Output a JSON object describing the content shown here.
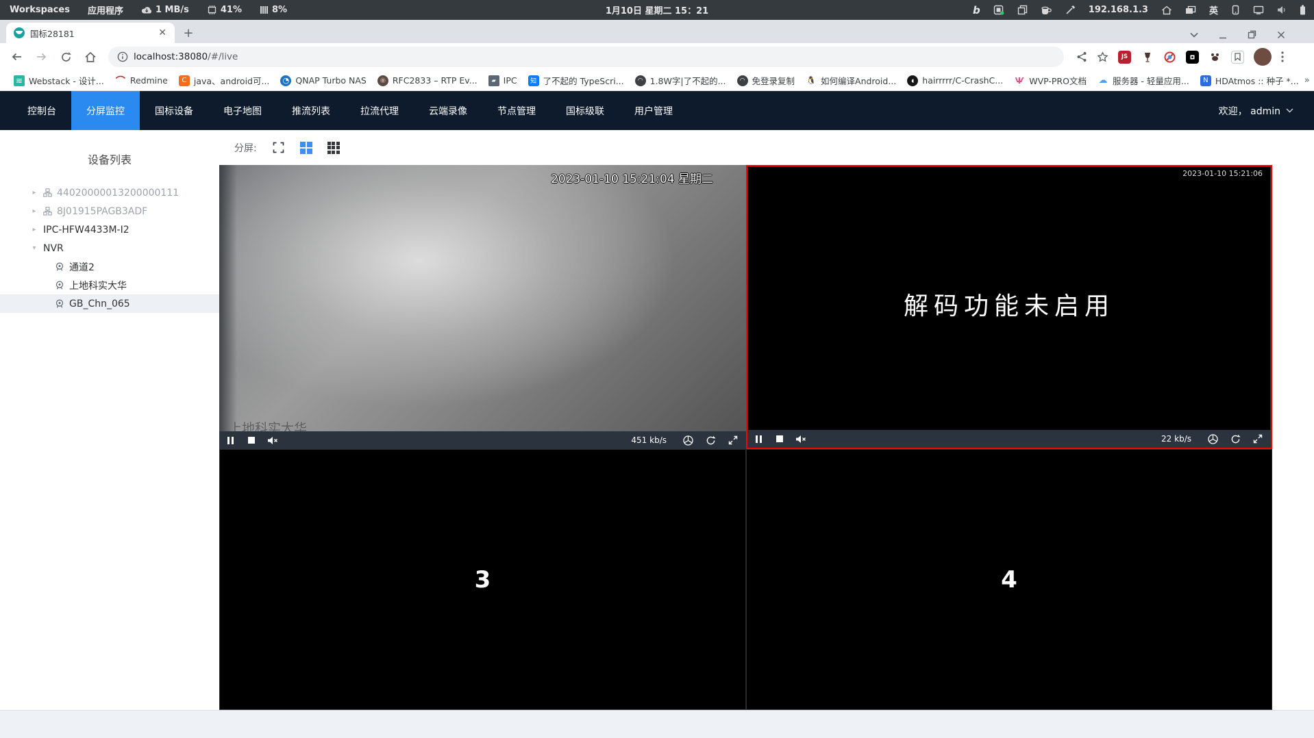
{
  "sysbar": {
    "workspaces": "Workspaces",
    "applications": "应用程序",
    "net_speed": "1 MB/s",
    "cpu": "41%",
    "mem": "8%",
    "clock": "1月10日 星期二 15：21",
    "ip": "192.168.1.3",
    "lang": "英"
  },
  "browser": {
    "tab_title": "国标28181",
    "close_glyph": "✕",
    "new_tab_glyph": "+",
    "url": {
      "host": "localhost:38080",
      "path": "/#/live"
    },
    "bookmarks": [
      {
        "label": "Webstack - 设计...",
        "icon": "layers-icon"
      },
      {
        "label": "Redmine",
        "icon": "redmine-icon"
      },
      {
        "label": "java、android可...",
        "icon": "c-badge-icon"
      },
      {
        "label": "QNAP Turbo NAS",
        "icon": "qnap-icon"
      },
      {
        "label": "RFC2833 – RTP Ev...",
        "icon": "knob-icon"
      },
      {
        "label": "IPC",
        "icon": "folder-icon"
      },
      {
        "label": "了不起的 TypeScri...",
        "icon": "zhihu-icon"
      },
      {
        "label": "1.8W字|了不起的...",
        "icon": "globe-icon"
      },
      {
        "label": "免登录复制",
        "icon": "globe-icon"
      },
      {
        "label": "如何编译Android...",
        "icon": "penguin-icon"
      },
      {
        "label": "hairrrrr/C-CrashC...",
        "icon": "github-icon"
      },
      {
        "label": "WVP-PRO文档",
        "icon": "wvp-icon"
      },
      {
        "label": "服务器 - 轻量应用...",
        "icon": "cloud-icon"
      },
      {
        "label": "HDAtmos :: 种子 *...",
        "icon": "n-icon"
      }
    ],
    "bookmarks_overflow": "»"
  },
  "nav": {
    "items": [
      {
        "label": "控制台"
      },
      {
        "label": "分屏监控"
      },
      {
        "label": "国标设备"
      },
      {
        "label": "电子地图"
      },
      {
        "label": "推流列表"
      },
      {
        "label": "拉流代理"
      },
      {
        "label": "云端录像"
      },
      {
        "label": "节点管理"
      },
      {
        "label": "国标级联"
      },
      {
        "label": "用户管理"
      }
    ],
    "active_index": 1,
    "welcome": "欢迎， admin"
  },
  "sidebar": {
    "title": "设备列表",
    "items": [
      {
        "label": "44020000013200000111",
        "level": 1,
        "type": "platform",
        "online": false
      },
      {
        "label": "8J01915PAGB3ADF",
        "level": 1,
        "type": "platform",
        "online": false
      },
      {
        "label": "IPC-HFW4433M-I2",
        "level": 1,
        "type": "device",
        "online": true
      },
      {
        "label": "NVR",
        "level": 1,
        "type": "device",
        "online": true,
        "expanded": true
      },
      {
        "label": "通道2",
        "level": 2,
        "type": "channel"
      },
      {
        "label": "上地科实大华",
        "level": 2,
        "type": "channel"
      },
      {
        "label": "GB_Chn_065",
        "level": 2,
        "type": "channel",
        "selected": true
      }
    ]
  },
  "toolbar": {
    "split_label": "分屏:"
  },
  "players": [
    {
      "timestamp": "2023-01-10 15:21:04 星期二",
      "watermark": "上地科实大华",
      "bitrate": "451 kb/s"
    },
    {
      "timestamp": "2023-01-10 15:21:06",
      "message": "解码功能未启用",
      "bitrate": "22 kb/s",
      "selected": true
    },
    {
      "placeholder": "3"
    },
    {
      "placeholder": "4"
    }
  ],
  "colors": {
    "nav_bg": "#0d1b2c",
    "nav_active": "#2b8af0",
    "grid_icon_active": "#3e8ef7",
    "selected_panel_border": "#ff0000",
    "player_bar": "#2b333f"
  },
  "icons": {
    "split_fullscreen": "corner-brackets",
    "split_2x2": "grid-2x2",
    "split_3x3": "grid-3x3",
    "pause": "❚❚",
    "stop": "■"
  }
}
